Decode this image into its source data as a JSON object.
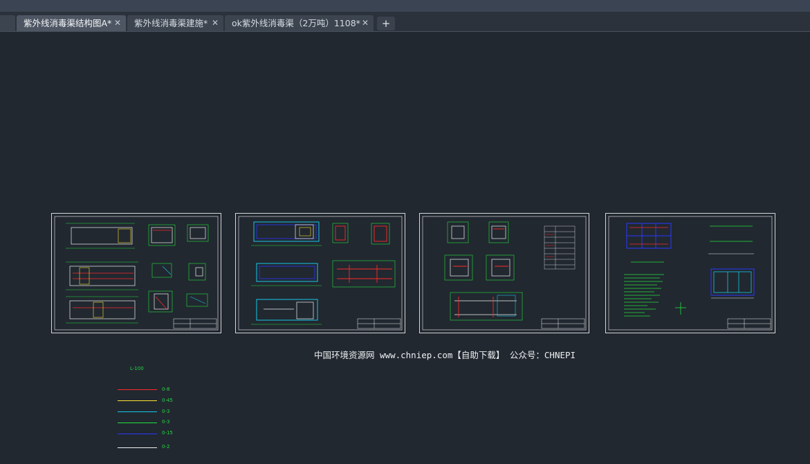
{
  "tabs": [
    {
      "label": "紫外线消毒渠结构图A*",
      "active": true
    },
    {
      "label": "紫外线消毒渠建施*",
      "active": false
    },
    {
      "label": "ok紫外线消毒渠（2万吨）1108*",
      "active": false
    }
  ],
  "new_tab_label": "+",
  "close_glyph": "✕",
  "watermark": "中国环境资源网  www.chniep.com【自助下载】  公众号：CHNEPI",
  "layer_legend": {
    "title": "L-100",
    "items": [
      {
        "label": "0-8",
        "color": "#ff2a2a"
      },
      {
        "label": "0-45",
        "color": "#ffe430"
      },
      {
        "label": "0-3",
        "color": "#18c8e8"
      },
      {
        "label": "0-3",
        "color": "#23e13b"
      },
      {
        "label": "0-15",
        "color": "#2a38ff"
      },
      {
        "label": "0-2",
        "color": "#f2f2f2"
      }
    ]
  },
  "colors": {
    "canvas": "#212830",
    "sheet_border": "#d8d8d8",
    "cad_green": "#23e13b",
    "cad_cyan": "#18c8e8",
    "cad_red": "#ff2a2a",
    "cad_yellow": "#ffe430",
    "cad_blue": "#2a38ff",
    "cad_white": "#f2f2f2"
  },
  "sheets": [
    "sheet-1",
    "sheet-2",
    "sheet-3",
    "sheet-4"
  ]
}
